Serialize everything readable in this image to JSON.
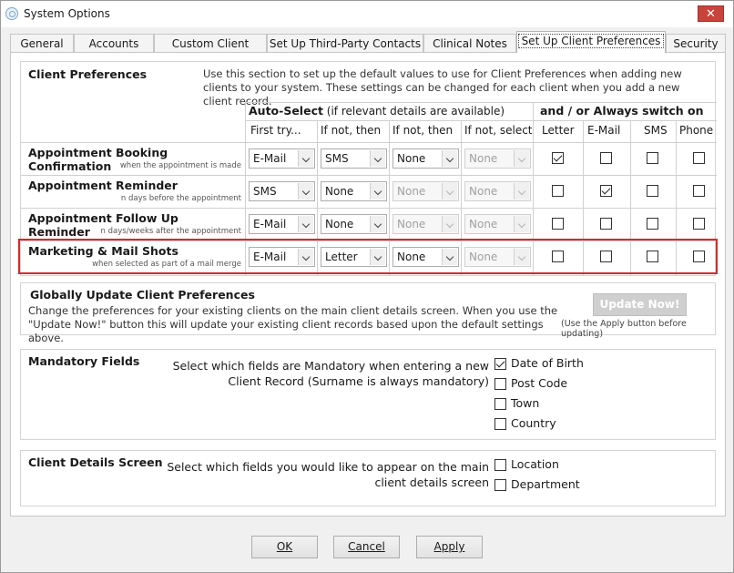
{
  "window": {
    "title": "System Options",
    "close": "✕"
  },
  "tabs": [
    {
      "label": "General"
    },
    {
      "label": "Accounts"
    },
    {
      "label": "Custom Client Fields"
    },
    {
      "label": "Set Up Third-Party Contacts"
    },
    {
      "label": "Clinical Notes"
    },
    {
      "label": "Set Up Client Preferences",
      "active": true
    },
    {
      "label": "Security"
    }
  ],
  "client_prefs": {
    "title": "Client Preferences",
    "description": "Use this section to set up the default values to use for Client Preferences when adding new clients to your system. These settings can be changed for each client when you add a new client record.",
    "auto_select_heading": "Auto-Select",
    "auto_select_note": "(if relevant details are available)",
    "always_heading": "and / or Always switch on",
    "columns": [
      "First try...",
      "If not, then",
      "If not, then",
      "If not, select"
    ],
    "switch_columns": [
      "Letter",
      "E-Mail",
      "SMS",
      "Phone"
    ],
    "rows": [
      {
        "label": "Appointment Booking Confirmation",
        "sub": "when the appointment is made",
        "selects": [
          "E-Mail",
          "SMS",
          "None",
          "None"
        ],
        "disabled": [
          false,
          false,
          false,
          true
        ],
        "checks": [
          true,
          false,
          false,
          false
        ]
      },
      {
        "label": "Appointment Reminder",
        "sub": "n days before the appointment",
        "selects": [
          "SMS",
          "None",
          "None",
          "None"
        ],
        "disabled": [
          false,
          false,
          true,
          true
        ],
        "checks": [
          false,
          true,
          false,
          false
        ]
      },
      {
        "label": "Appointment Follow Up Reminder",
        "sub": "n days/weeks after the appointment",
        "selects": [
          "E-Mail",
          "None",
          "None",
          "None"
        ],
        "disabled": [
          false,
          false,
          true,
          true
        ],
        "checks": [
          false,
          false,
          false,
          false
        ]
      },
      {
        "label": "Marketing & Mail Shots",
        "sub": "when selected as part of a mail merge",
        "selects": [
          "E-Mail",
          "Letter",
          "None",
          "None"
        ],
        "disabled": [
          false,
          false,
          false,
          true
        ],
        "checks": [
          false,
          false,
          false,
          false
        ]
      }
    ]
  },
  "global_update": {
    "title": "Globally Update Client Preferences",
    "description": "Change the preferences for your existing clients on the main client details screen. When you use the \"Update Now!\" button this will update your existing client records based upon the default settings above.",
    "button": "Update Now!",
    "note": "(Use the Apply button before updating)"
  },
  "mandatory": {
    "title": "Mandatory Fields",
    "description": "Select which fields are Mandatory when entering a new Client Record (Surname is always mandatory)",
    "options": [
      {
        "label": "Date of Birth",
        "checked": true
      },
      {
        "label": "Post Code",
        "checked": false
      },
      {
        "label": "Town",
        "checked": false
      },
      {
        "label": "Country",
        "checked": false
      }
    ]
  },
  "details_screen": {
    "title": "Client Details Screen",
    "description": "Select which fields you would like to appear on the main client details screen",
    "options": [
      {
        "label": "Location",
        "checked": false
      },
      {
        "label": "Department",
        "checked": false
      }
    ]
  },
  "footer": {
    "ok": "OK",
    "cancel": "Cancel",
    "apply": "Apply"
  }
}
